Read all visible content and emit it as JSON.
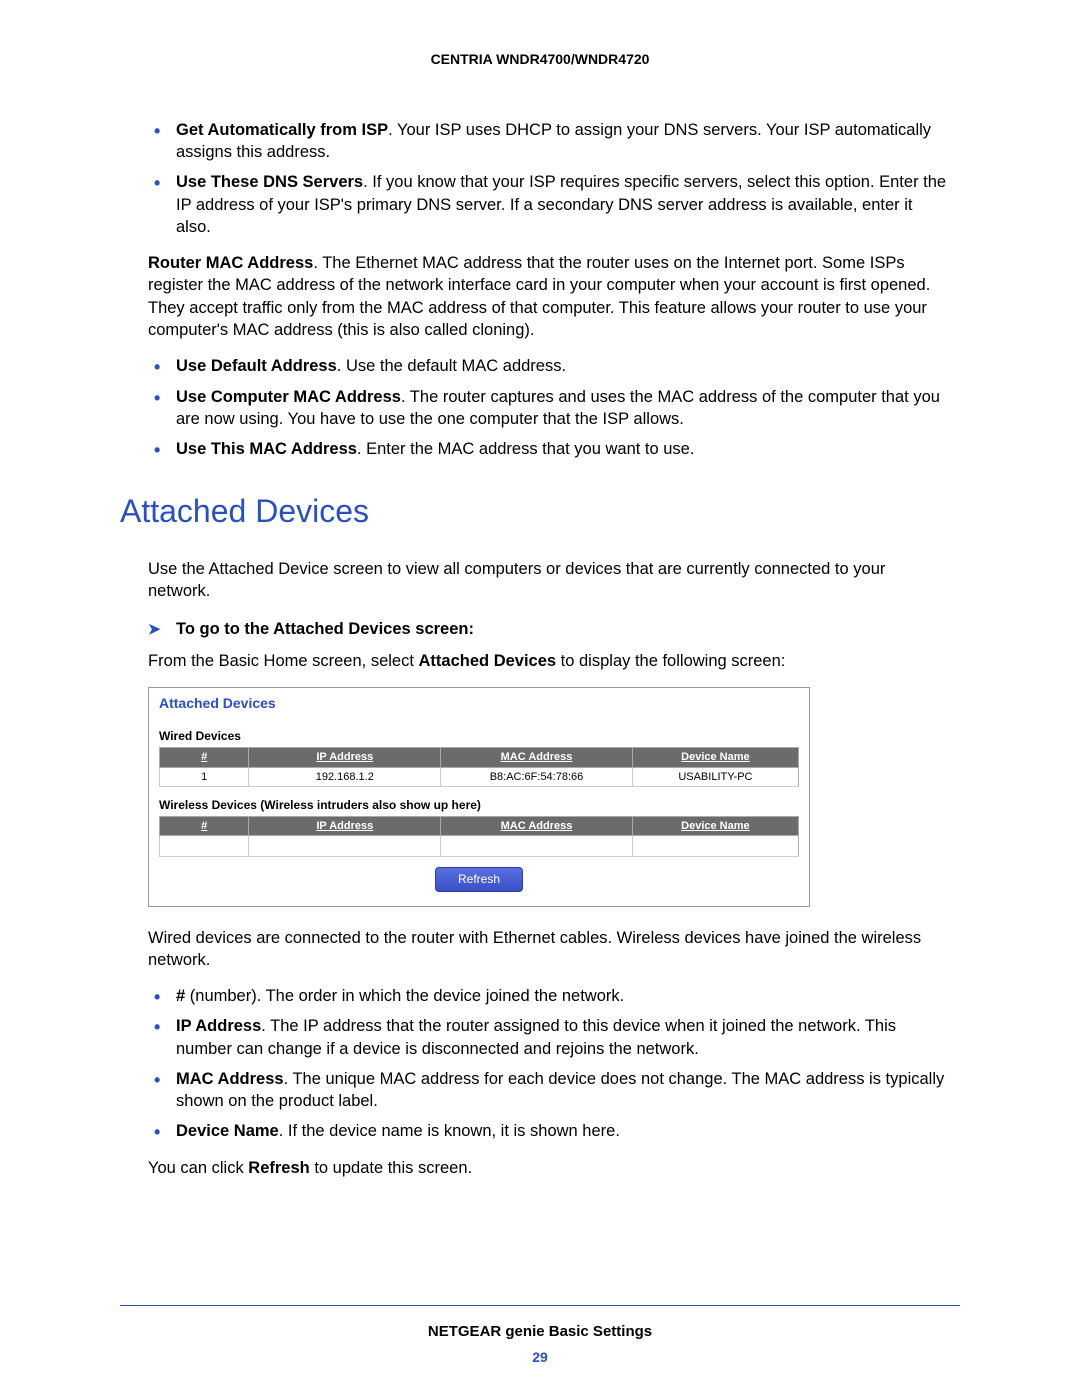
{
  "header": "CENTRIA WNDR4700/WNDR4720",
  "dns": {
    "items": [
      {
        "lead": "Get Automatically from ISP",
        "rest": ". Your ISP uses DHCP to assign your DNS servers. Your ISP automatically assigns this address."
      },
      {
        "lead": "Use These DNS Servers",
        "rest": ". If you know that your ISP requires specific servers, select this option. Enter the IP address of your ISP's primary DNS server. If a secondary DNS server address is available, enter it also."
      }
    ]
  },
  "mac": {
    "lead": "Router MAC Address",
    "rest": ". The Ethernet MAC address that the router uses on the Internet port. Some ISPs register the MAC address of the network interface card in your computer when your account is first opened. They accept traffic only from the MAC address of that computer. This feature allows your router to use your computer's MAC address (this is also called cloning).",
    "items": [
      {
        "lead": "Use Default Address",
        "rest": ". Use the default MAC address."
      },
      {
        "lead": "Use Computer MAC Address",
        "rest": ". The router captures and uses the MAC address of the computer that you are now using. You have to use the one computer that the ISP allows."
      },
      {
        "lead": "Use This MAC Address",
        "rest": ". Enter the MAC address that you want to use."
      }
    ]
  },
  "section_title": "Attached Devices",
  "attached_intro": "Use the Attached Device screen to view all computers or devices that are currently connected to your network.",
  "step_heading": "To go to the Attached Devices screen:",
  "step_line_pre": "From the Basic Home screen, select ",
  "step_line_bold": "Attached Devices",
  "step_line_post": " to display the following screen:",
  "shot": {
    "title": "Attached Devices",
    "wired_label": "Wired Devices",
    "wireless_label": "Wireless Devices (Wireless intruders also show up here)",
    "cols": {
      "num": "#",
      "ip": "IP Address",
      "mac": "MAC Address",
      "name": "Device Name"
    },
    "wired_rows": [
      {
        "num": "1",
        "ip": "192.168.1.2",
        "mac": "B8:AC:6F:54:78:66",
        "name": "USABILITY-PC"
      }
    ],
    "refresh": "Refresh"
  },
  "after_shot": "Wired devices are connected to the router with Ethernet cables. Wireless devices have joined the wireless network.",
  "field_items": [
    {
      "lead": "#",
      "rest": " (number). The order in which the device joined the network."
    },
    {
      "lead": "IP Address",
      "rest": ". The IP address that the router assigned to this device when it joined the network. This number can change if a device is disconnected and rejoins the network."
    },
    {
      "lead": "MAC Address",
      "rest": ". The unique MAC address for each device does not change. The MAC address is typically shown on the product label."
    },
    {
      "lead": "Device Name",
      "rest": ". If the device name is known, it is shown here."
    }
  ],
  "refresh_line_pre": "You can click ",
  "refresh_line_bold": "Refresh",
  "refresh_line_post": " to update this screen.",
  "footer_title": "NETGEAR genie Basic Settings",
  "footer_page": "29"
}
